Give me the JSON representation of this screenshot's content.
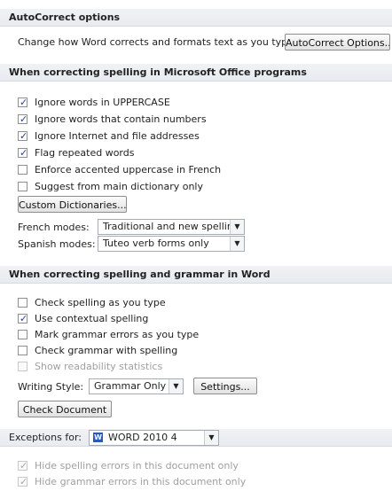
{
  "autocorrect": {
    "header": "AutoCorrect options",
    "description": "Change how Word corrects and formats text as you type:",
    "button": "AutoCorrect Options..."
  },
  "office_spelling": {
    "header": "When correcting spelling in Microsoft Office programs",
    "options": [
      {
        "label": "Ignore words in UPPERCASE",
        "checked": true
      },
      {
        "label": "Ignore words that contain numbers",
        "checked": true
      },
      {
        "label": "Ignore Internet and file addresses",
        "checked": true
      },
      {
        "label": "Flag repeated words",
        "checked": true
      },
      {
        "label": "Enforce accented uppercase in French",
        "checked": false
      },
      {
        "label": "Suggest from main dictionary only",
        "checked": false
      }
    ],
    "custom_dictionaries_button": "Custom Dictionaries...",
    "french_modes_label": "French modes:",
    "french_modes_value": "Traditional and new spellings",
    "spanish_modes_label": "Spanish modes:",
    "spanish_modes_value": "Tuteo verb forms only"
  },
  "word_grammar": {
    "header": "When correcting spelling and grammar in Word",
    "options": [
      {
        "label": "Check spelling as you type",
        "checked": false,
        "disabled": false
      },
      {
        "label": "Use contextual spelling",
        "checked": true,
        "disabled": false
      },
      {
        "label": "Mark grammar errors as you type",
        "checked": false,
        "disabled": false
      },
      {
        "label": "Check grammar with spelling",
        "checked": false,
        "disabled": false
      },
      {
        "label": "Show readability statistics",
        "checked": false,
        "disabled": true
      }
    ],
    "writing_style_label": "Writing Style:",
    "writing_style_value": "Grammar Only",
    "settings_button": "Settings...",
    "check_document_button": "Check Document"
  },
  "exceptions": {
    "label": "Exceptions for:",
    "document_icon": "W",
    "document_value": "WORD 2010 4",
    "options": [
      {
        "label": "Hide spelling errors in this document only",
        "checked": true,
        "disabled": true
      },
      {
        "label": "Hide grammar errors in this document only",
        "checked": true,
        "disabled": true
      }
    ]
  },
  "icons": {
    "checkmark": "✓",
    "dropdown_arrow": "▼"
  }
}
